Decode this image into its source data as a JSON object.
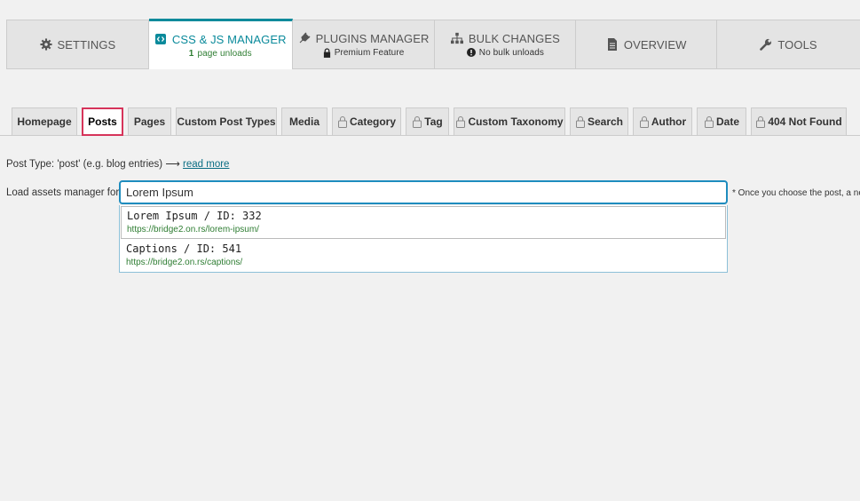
{
  "topnav": {
    "tabs": [
      {
        "label": "SETTINGS",
        "icon": "gear-icon",
        "sub": ""
      },
      {
        "label": "CSS & JS MANAGER",
        "icon": "code-icon",
        "sub_count": "1",
        "sub": "page unloads"
      },
      {
        "label": "PLUGINS MANAGER",
        "icon": "plug-icon",
        "sub": "Premium Feature"
      },
      {
        "label": "BULK CHANGES",
        "icon": "sitemap-icon",
        "sub": "No bulk unloads"
      },
      {
        "label": "OVERVIEW",
        "icon": "document-icon",
        "sub": ""
      },
      {
        "label": "TOOLS",
        "icon": "wrench-icon",
        "sub": ""
      }
    ]
  },
  "subtabs": [
    {
      "label": "Homepage",
      "locked": false
    },
    {
      "label": "Posts",
      "locked": false,
      "active": true
    },
    {
      "label": "Pages",
      "locked": false
    },
    {
      "label": "Custom Post Types",
      "locked": false
    },
    {
      "label": "Media",
      "locked": false
    },
    {
      "label": "Category",
      "locked": true
    },
    {
      "label": "Tag",
      "locked": true
    },
    {
      "label": "Custom Taxonomy",
      "locked": true
    },
    {
      "label": "Search",
      "locked": true
    },
    {
      "label": "Author",
      "locked": true
    },
    {
      "label": "Date",
      "locked": true
    },
    {
      "label": "404 Not Found",
      "locked": true
    }
  ],
  "post_type": {
    "text": "Post Type: 'post' (e.g. blog entries) ⟶",
    "link": "read more"
  },
  "loader": {
    "label": "Load assets manager for:",
    "value": "Lorem Ipsum",
    "note": "* Once you choose the post, a new"
  },
  "results": [
    {
      "title": "Lorem Ipsum / ID: 332",
      "url": "https://bridge2.on.rs/lorem-ipsum/"
    },
    {
      "title": "Captions / ID: 541",
      "url": "https://bridge2.on.rs/captions/"
    }
  ],
  "colors": {
    "accent": "#0a8a9b",
    "active_subtab_border": "#d6345a",
    "url_green": "#2e7d32"
  }
}
